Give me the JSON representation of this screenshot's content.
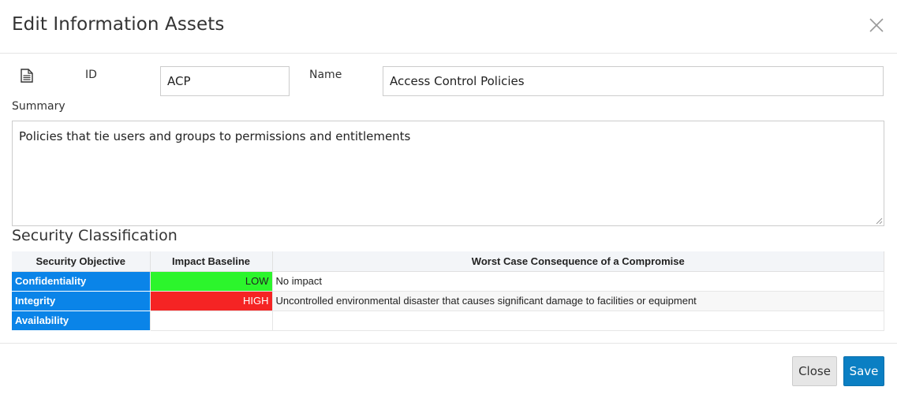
{
  "header": {
    "title": "Edit Information Assets"
  },
  "form": {
    "id_label": "ID",
    "id_value": "ACP",
    "name_label": "Name",
    "name_value": "Access Control Policies",
    "summary_label": "Summary",
    "summary_value": "Policies that tie users and groups to permissions and entitlements"
  },
  "security": {
    "title": "Security Classification",
    "columns": [
      "Security Objective",
      "Impact Baseline",
      "Worst Case Consequence of a Compromise"
    ],
    "rows": [
      {
        "objective": "Confidentiality",
        "impact": "LOW",
        "consequence": "No impact"
      },
      {
        "objective": "Integrity",
        "impact": "HIGH",
        "consequence": "Uncontrolled environmental disaster that causes significant damage to facilities or equipment"
      },
      {
        "objective": "Availability",
        "impact": "",
        "consequence": ""
      }
    ],
    "colors": {
      "objective": "#0a84e8",
      "low": "#2cf52c",
      "high": "#f52424"
    }
  },
  "footer": {
    "close_label": "Close",
    "save_label": "Save"
  },
  "icons": {
    "close": "close-icon",
    "document": "document-icon"
  }
}
